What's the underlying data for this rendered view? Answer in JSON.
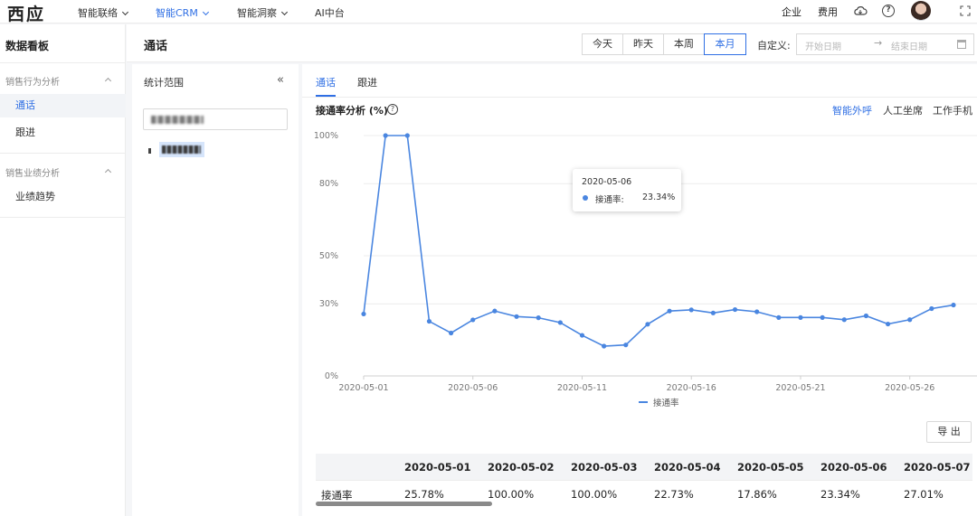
{
  "topnav": {
    "logo": "西应",
    "items": [
      {
        "label": "智能联络",
        "caret": true
      },
      {
        "label": "智能CRM",
        "caret": true,
        "active": true
      },
      {
        "label": "智能洞察",
        "caret": true
      },
      {
        "label": "AI中台",
        "caret": false
      }
    ],
    "right": {
      "enterprise": "企业",
      "cost": "费用"
    }
  },
  "sidebar": {
    "title": "数据看板",
    "groups": [
      {
        "label": "销售行为分析",
        "items": [
          {
            "label": "通话",
            "active": true
          },
          {
            "label": "跟进"
          }
        ]
      },
      {
        "label": "销售业绩分析",
        "items": [
          {
            "label": "业绩趋势"
          }
        ]
      }
    ]
  },
  "header": {
    "title": "通话",
    "periods": [
      {
        "label": "今天"
      },
      {
        "label": "昨天"
      },
      {
        "label": "本周"
      },
      {
        "label": "本月",
        "active": true
      }
    ],
    "custom_label": "自定义:",
    "start_placeholder": "开始日期",
    "end_placeholder": "结束日期"
  },
  "scope": {
    "title": "统计范围"
  },
  "main": {
    "tabs": [
      {
        "label": "通话",
        "active": true
      },
      {
        "label": "跟进"
      }
    ],
    "chart_title": "接通率分析 (%)",
    "channel_options": [
      {
        "label": "智能外呼",
        "active": true
      },
      {
        "label": "人工坐席"
      },
      {
        "label": "工作手机"
      }
    ],
    "export_label": "导 出"
  },
  "tooltip": {
    "date": "2020-05-06",
    "series": "接通率:",
    "value": "23.34%"
  },
  "chart_data": {
    "type": "line",
    "x": [
      "2020-05-01",
      "2020-05-02",
      "2020-05-03",
      "2020-05-04",
      "2020-05-05",
      "2020-05-06",
      "2020-05-07",
      "2020-05-08",
      "2020-05-09",
      "2020-05-10",
      "2020-05-11",
      "2020-05-12",
      "2020-05-13",
      "2020-05-14",
      "2020-05-15",
      "2020-05-16",
      "2020-05-17",
      "2020-05-18",
      "2020-05-19",
      "2020-05-20",
      "2020-05-21",
      "2020-05-22",
      "2020-05-23",
      "2020-05-24",
      "2020-05-25",
      "2020-05-26",
      "2020-05-27",
      "2020-05-28"
    ],
    "x_tick_labels": [
      "2020-05-01",
      "2020-05-06",
      "2020-05-11",
      "2020-05-16",
      "2020-05-21",
      "2020-05-26"
    ],
    "y_tick_labels": [
      "0%",
      "30%",
      "50%",
      "80%",
      "100%"
    ],
    "y_ticks": [
      0,
      30,
      50,
      80,
      100
    ],
    "ylim": [
      0,
      100
    ],
    "grid": true,
    "legend_position": "bottom-center",
    "series": [
      {
        "name": "接通率",
        "color": "#4a86e0",
        "values": [
          25.78,
          100.0,
          100.0,
          22.73,
          17.86,
          23.34,
          27.01,
          24.7,
          24.2,
          22.2,
          16.9,
          12.4,
          12.9,
          21.5,
          27.0,
          27.5,
          26.2,
          27.6,
          26.7,
          24.3,
          24.3,
          24.3,
          23.4,
          25.0,
          21.6,
          23.4,
          28.0,
          29.5
        ]
      }
    ]
  },
  "table": {
    "dates": [
      "2020-05-01",
      "2020-05-02",
      "2020-05-03",
      "2020-05-04",
      "2020-05-05",
      "2020-05-06",
      "2020-05-07"
    ],
    "row_label": "接通率",
    "values": [
      "25.78%",
      "100.00%",
      "100.00%",
      "22.73%",
      "17.86%",
      "23.34%",
      "27.01%"
    ]
  }
}
